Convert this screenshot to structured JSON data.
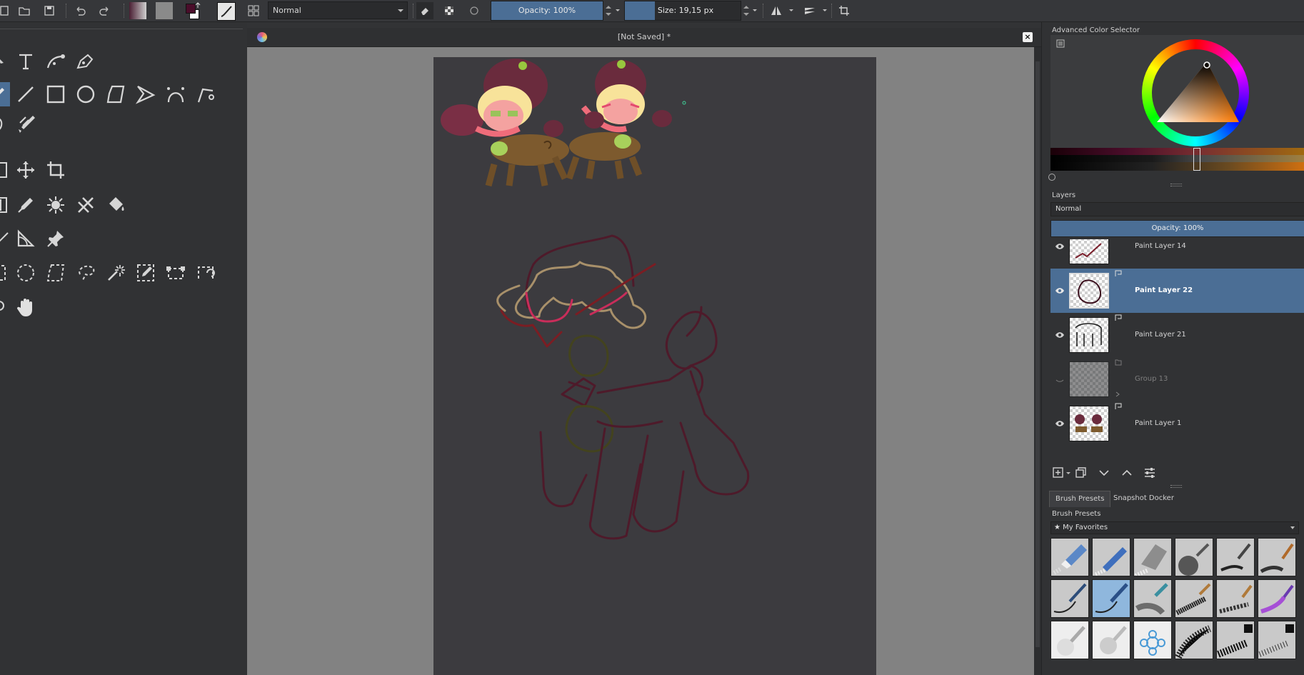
{
  "toolbar": {
    "blend_mode": "Normal",
    "opacity_label": "Opacity: 100%",
    "opacity_value": 1.0,
    "size_label": "Size: 19,15 px",
    "colors": {
      "foreground": "#4a0d2a",
      "background": "#ffffff"
    }
  },
  "document": {
    "title": "[Not Saved]  *"
  },
  "dock": {
    "color_selector_title": "Advanced Color Selector",
    "layers_title": "Layers",
    "layers_blend_mode": "Normal",
    "layers_opacity_label": "Opacity:  100%",
    "layers": [
      {
        "name": "Paint Layer 14",
        "visible": true,
        "selected": false
      },
      {
        "name": "Paint Layer 22",
        "visible": true,
        "selected": true
      },
      {
        "name": "Paint Layer 21",
        "visible": true,
        "selected": false
      },
      {
        "name": "Group 13",
        "visible": false,
        "selected": false
      },
      {
        "name": "Paint Layer 1",
        "visible": true,
        "selected": false
      }
    ],
    "brush_tabs": [
      "Brush Presets",
      "Snapshot Docker"
    ],
    "brush_presets_title": "Brush Presets",
    "brush_tag": "★ My Favorites"
  }
}
